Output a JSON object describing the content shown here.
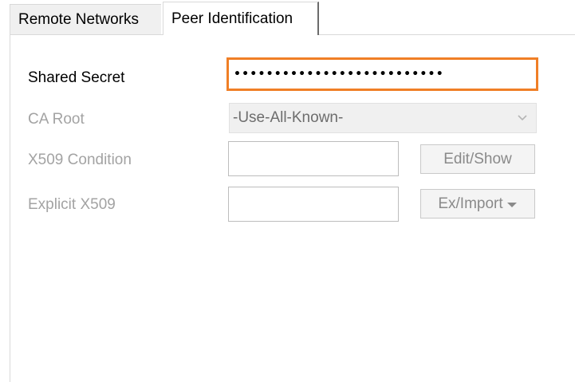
{
  "tabs": {
    "remote_networks": "Remote Networks",
    "peer_identification": "Peer Identification",
    "active": "peer_identification"
  },
  "form": {
    "shared_secret": {
      "label": "Shared Secret",
      "masked_value": "••••••••••••••••••••••••••",
      "focused": true
    },
    "ca_root": {
      "label": "CA Root",
      "selected": "-Use-All-Known-",
      "enabled": false
    },
    "x509_condition": {
      "label": "X509 Condition",
      "value": "",
      "button_label": "Edit/Show",
      "enabled": false
    },
    "explicit_x509": {
      "label": "Explicit X509",
      "value": "",
      "button_label": "Ex/Import",
      "enabled": false
    }
  },
  "colors": {
    "focus_border": "#f07f26",
    "disabled_text": "#a3a3a3",
    "tab_inactive_bg": "#f0f0f0"
  },
  "icons": {
    "combo_dropdown": "chevron-down-icon",
    "import_menu": "caret-down-icon"
  }
}
